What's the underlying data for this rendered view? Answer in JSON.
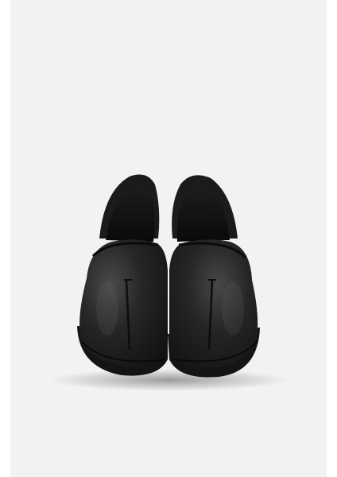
{
  "image": {
    "subject": "pair-of-black-leather-slip-on-shoes",
    "colors": {
      "background": "#ffffff",
      "panel": "#f2f2f2",
      "leather": "#1f1f1f",
      "leather_highlight": "#4a4a4a",
      "lining": "#0f0f0f",
      "sole": "#151515"
    }
  }
}
